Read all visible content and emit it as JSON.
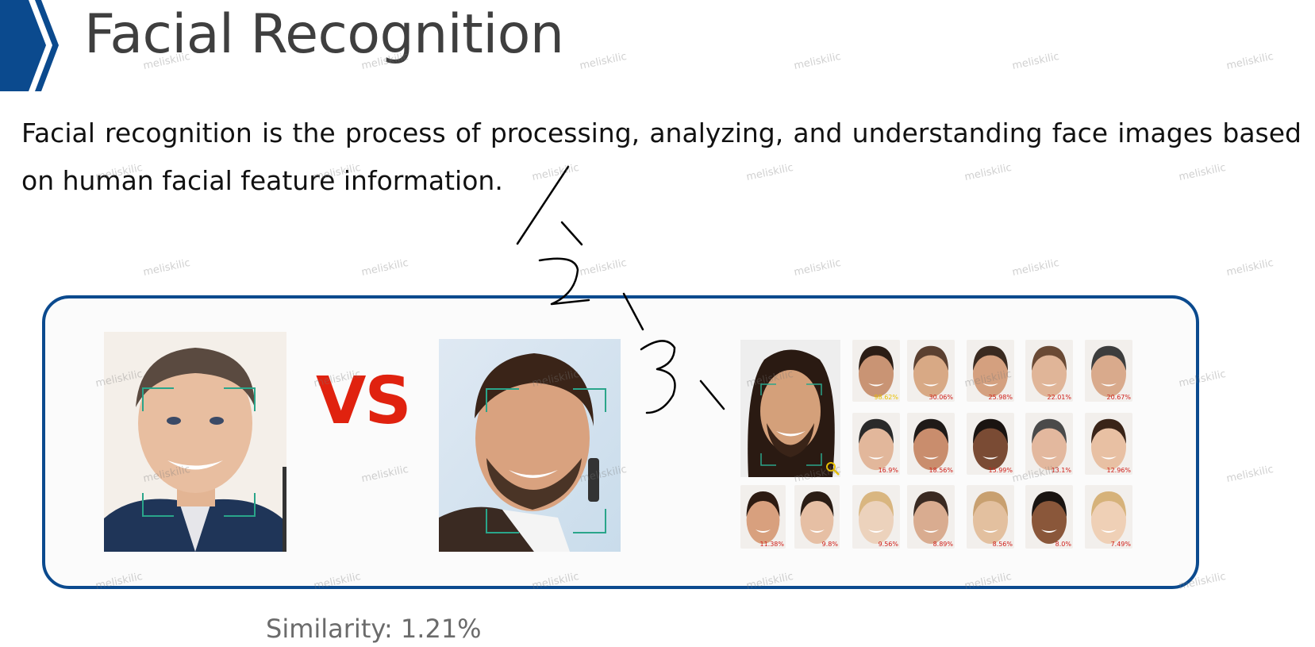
{
  "header": {
    "title": "Facial Recognition"
  },
  "body": {
    "description": "Facial recognition is the process of processing, analyzing, and understanding face images based on human facial feature information."
  },
  "comparison": {
    "vs_label": "VS",
    "similarity_text": "Similarity: 1.21%"
  },
  "search_results": {
    "scores": [
      "98.62%",
      "30.06%",
      "25.98%",
      "22.01%",
      "20.67%",
      "16.9%",
      "18.56%",
      "15.99%",
      "13.1%",
      "12.96%",
      "11.38%",
      "9.8%",
      "9.56%",
      "8.89%",
      "8.56%",
      "8.0%",
      "7.49%"
    ]
  },
  "watermark": "meliskilic",
  "colors": {
    "brand_blue": "#0b4a8e",
    "vs_red": "#e0220f",
    "face_box": "#2aa58a"
  }
}
